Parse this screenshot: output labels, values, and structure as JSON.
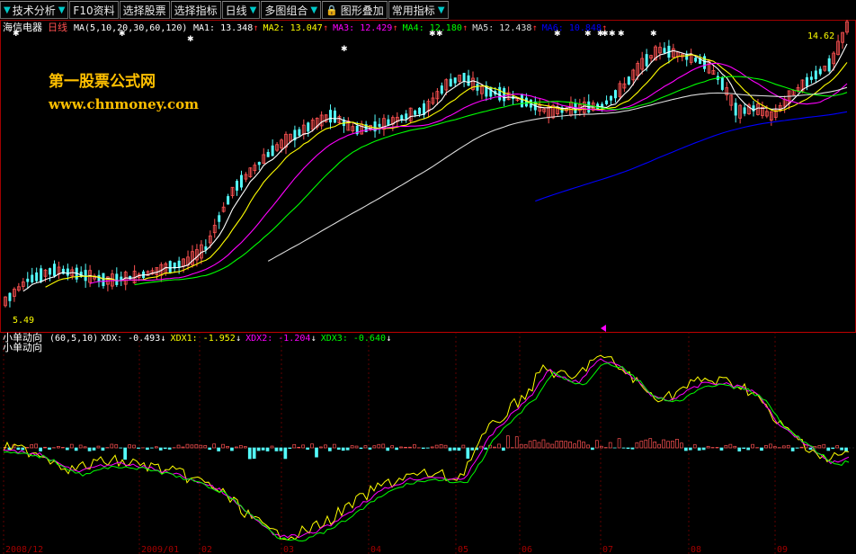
{
  "toolbar": [
    {
      "label": "技术分析",
      "icon": "dropdown-arrow-icon",
      "trail": "dropdown-arrow-icon"
    },
    {
      "label": "F10资料",
      "icon": "",
      "trail": ""
    },
    {
      "label": "选择股票",
      "icon": "",
      "trail": ""
    },
    {
      "label": "选择指标",
      "icon": "",
      "trail": ""
    },
    {
      "label": "日线",
      "icon": "",
      "trail": "dropdown-arrow-icon"
    },
    {
      "label": "多图组合",
      "icon": "",
      "trail": "dropdown-arrow-icon"
    },
    {
      "label": "图形叠加",
      "icon": "lock-icon",
      "trail": ""
    },
    {
      "label": "常用指标",
      "icon": "",
      "trail": "dropdown-arrow-icon"
    }
  ],
  "stock": {
    "name": "海信电器",
    "period": "日线"
  },
  "ma_header": {
    "formula": "MA(5,10,20,30,60,120)",
    "items": [
      {
        "label": "MA1:",
        "value": "13.348",
        "arrow": "↑",
        "color": "#ffffff"
      },
      {
        "label": "MA2:",
        "value": "13.047",
        "arrow": "↑",
        "color": "#ffff00"
      },
      {
        "label": "MA3:",
        "value": "12.429",
        "arrow": "↑",
        "color": "#ff00ff"
      },
      {
        "label": "MA4:",
        "value": "12.180",
        "arrow": "↑",
        "color": "#00ff00"
      },
      {
        "label": "MA5:",
        "value": "12.438",
        "arrow": "↑",
        "color": "#dcdcdc"
      },
      {
        "label": "MA6:",
        "value": "10.848",
        "arrow": "↑",
        "color": "#0000ff"
      }
    ]
  },
  "watermark": {
    "title": "第一股票公式网",
    "url": "www.chnmoney.com"
  },
  "price_labels": {
    "high": "14.62",
    "low": "5.49"
  },
  "indicator": {
    "name": "小单动向",
    "params": "(60,5,10)",
    "subtitle": "小单动向",
    "items": [
      {
        "label": "XDX:",
        "value": "-0.493",
        "arrow": "↓",
        "color": "#ffffff"
      },
      {
        "label": "XDX1:",
        "value": "-1.952",
        "arrow": "↓",
        "color": "#ffff00"
      },
      {
        "label": "XDX2:",
        "value": "-1.204",
        "arrow": "↓",
        "color": "#ff00ff"
      },
      {
        "label": "XDX3:",
        "value": "-0.640",
        "arrow": "↓",
        "color": "#00ff00"
      }
    ]
  },
  "time_axis": [
    "2008/12",
    "2009/01",
    "02",
    "03",
    "04",
    "05",
    "06",
    "07",
    "08",
    "09"
  ],
  "colors": {
    "up": "#ff5252",
    "down": "#54fcfc",
    "ma1": "#ffffff",
    "ma2": "#ffff00",
    "ma3": "#ff00ff",
    "ma4": "#00ff00",
    "ma5": "#dcdcdc",
    "ma6": "#0000ff",
    "border": "#c00000",
    "period": "#ff5050"
  }
}
